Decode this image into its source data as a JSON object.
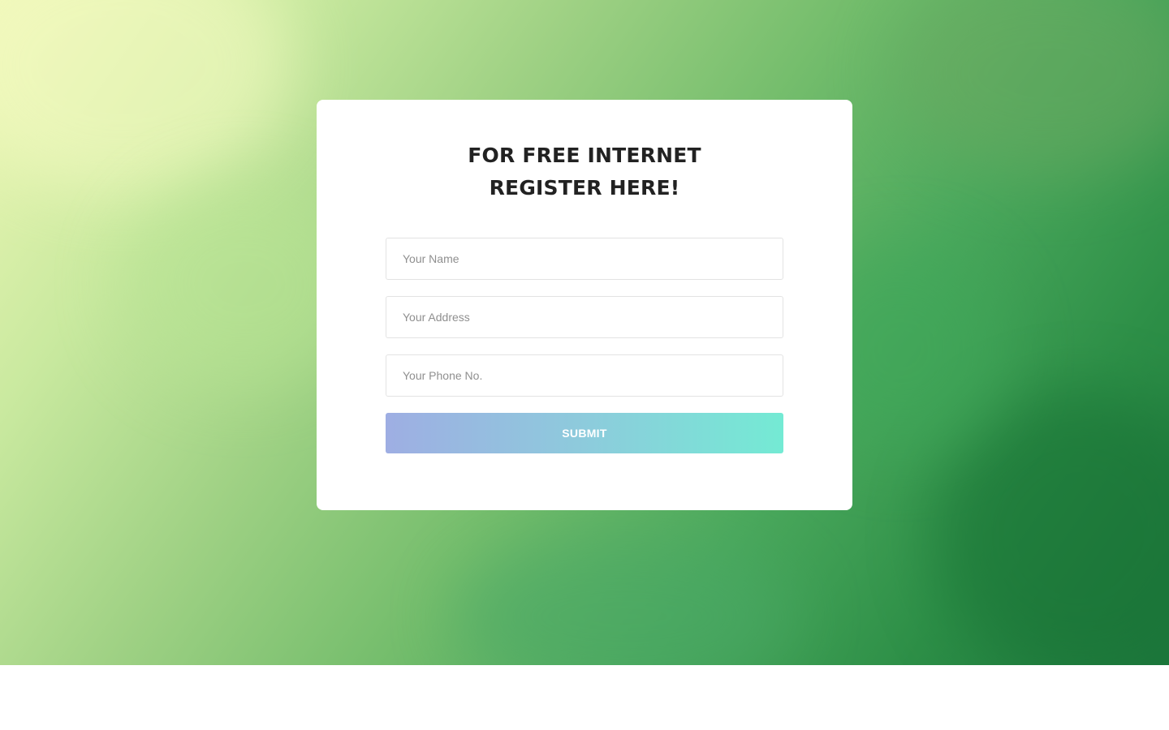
{
  "form": {
    "title_line1": "FOR FREE INTERNET",
    "title_line2": "REGISTER HERE!",
    "name_placeholder": "Your Name",
    "address_placeholder": "Your Address",
    "phone_placeholder": "Your Phone No.",
    "submit_label": "SUBMIT"
  },
  "colors": {
    "background_light": "#eef7b6",
    "background_dark": "#1c773c",
    "button_start": "#9eaee3",
    "button_end": "#74ead4",
    "title_text": "#222222"
  }
}
